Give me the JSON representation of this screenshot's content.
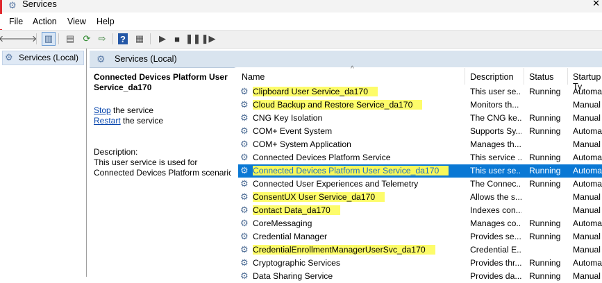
{
  "window": {
    "title": "Services"
  },
  "menu": [
    "File",
    "Action",
    "View",
    "Help"
  ],
  "toolbar": {
    "icons": [
      "back-arrow-icon",
      "forward-arrow-icon",
      "console-tree-icon",
      "properties-icon",
      "refresh-icon",
      "export-list-icon",
      "help-icon",
      "details-view-icon",
      "play-icon",
      "stop-icon",
      "pause-icon",
      "resume-icon"
    ]
  },
  "tree": {
    "label": "Services (Local)"
  },
  "content_header": {
    "label": "Services (Local)"
  },
  "description": {
    "service_title": "Connected Devices Platform User Service_da170",
    "stop_link": "Stop",
    "stop_rest": " the service",
    "restart_link": "Restart",
    "restart_rest": " the service",
    "label": "Description:",
    "text_line1": "This user service is used for",
    "text_line2": "Connected Devices Platform scenarios"
  },
  "columns": {
    "name": "Name",
    "description": "Description",
    "status": "Status",
    "startup": "Startup Ty"
  },
  "rows": [
    {
      "name": "Clipboard User Service_da170",
      "description": "This user se...",
      "status": "Running",
      "startup": "Automa",
      "highlight": true
    },
    {
      "name": "Cloud Backup and Restore Service_da170",
      "description": "Monitors th...",
      "status": "",
      "startup": "Manual",
      "highlight": true
    },
    {
      "name": "CNG Key Isolation",
      "description": "The CNG ke...",
      "status": "Running",
      "startup": "Manual"
    },
    {
      "name": "COM+ Event System",
      "description": "Supports Sy...",
      "status": "Running",
      "startup": "Automa"
    },
    {
      "name": "COM+ System Application",
      "description": "Manages th...",
      "status": "",
      "startup": "Manual"
    },
    {
      "name": "Connected Devices Platform Service",
      "description": "This service ...",
      "status": "Running",
      "startup": "Automa"
    },
    {
      "name": "Connected Devices Platform User Service_da170",
      "description": "This user se...",
      "status": "Running",
      "startup": "Automa",
      "highlight": true,
      "selected": true
    },
    {
      "name": "Connected User Experiences and Telemetry",
      "description": "The Connec...",
      "status": "Running",
      "startup": "Automa"
    },
    {
      "name": "ConsentUX User Service_da170",
      "description": "Allows the s...",
      "status": "",
      "startup": "Manual",
      "highlight": true
    },
    {
      "name": "Contact Data_da170",
      "description": "Indexes con...",
      "status": "",
      "startup": "Manual",
      "highlight": true
    },
    {
      "name": "CoreMessaging",
      "description": "Manages co...",
      "status": "Running",
      "startup": "Automa"
    },
    {
      "name": "Credential Manager",
      "description": "Provides se...",
      "status": "Running",
      "startup": "Manual"
    },
    {
      "name": "CredentialEnrollmentManagerUserSvc_da170",
      "description": "Credential E...",
      "status": "",
      "startup": "Manual",
      "highlight": true
    },
    {
      "name": "Cryptographic Services",
      "description": "Provides thr...",
      "status": "Running",
      "startup": "Automa"
    },
    {
      "name": "Data Sharing Service",
      "description": "Provides da...",
      "status": "Running",
      "startup": "Manual"
    }
  ],
  "colors": {
    "selection": "#0a78d4",
    "highlight": "#fdfc6a"
  }
}
